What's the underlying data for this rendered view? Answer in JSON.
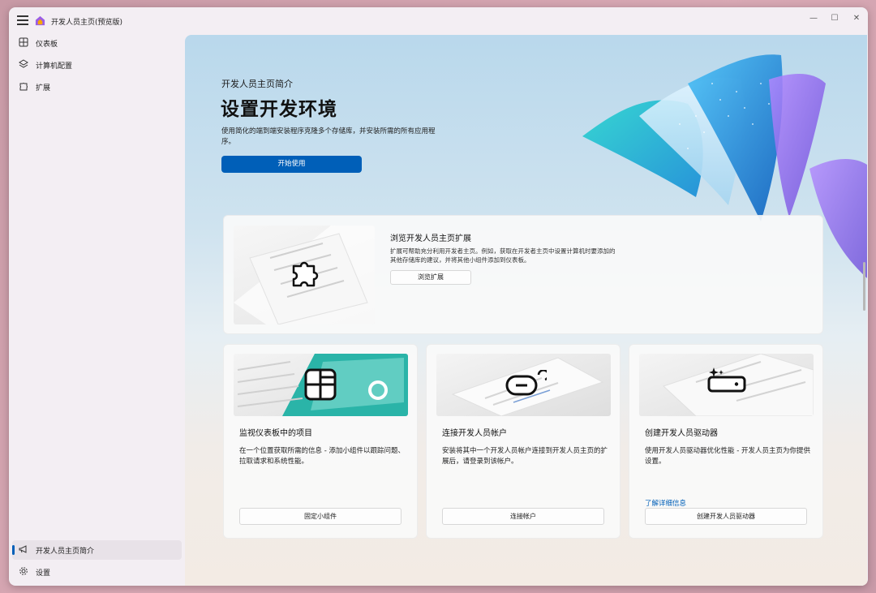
{
  "window": {
    "title": "开发人员主页(预览版)",
    "controls": {
      "minimize": "—",
      "maximize": "☐",
      "close": "✕"
    }
  },
  "sidebar": {
    "items": [
      {
        "label": "仪表板",
        "icon": "dashboard-icon"
      },
      {
        "label": "计算机配置",
        "icon": "layers-icon"
      },
      {
        "label": "扩展",
        "icon": "puzzle-icon"
      }
    ],
    "footer_items": [
      {
        "label": "开发人员主页简介",
        "icon": "megaphone-icon",
        "active": true
      },
      {
        "label": "设置",
        "icon": "gear-icon"
      }
    ]
  },
  "hero": {
    "subtitle": "开发人员主页简介",
    "title": "设置开发环境",
    "description": "使用简化的端到端安装程序克隆多个存储库，并安装所需的所有应用程序。",
    "button": "开始使用"
  },
  "extensions_card": {
    "title": "浏览开发人员主页扩展",
    "description": "扩展可帮助充分利用开发者主页。例如，获取在开发者主页中设置计算机时要添加的其他存储库的建议，并将其他小组件添加到仪表板。",
    "button": "浏览扩展"
  },
  "cards": [
    {
      "title": "监视仪表板中的项目",
      "description": "在一个位置获取所需的信息 - 添加小组件以跟踪问题、拉取请求和系统性能。",
      "button": "固定小组件",
      "icon": "widget-grid-icon"
    },
    {
      "title": "连接开发人员帐户",
      "description": "安装将其中一个开发人员帐户连接到开发人员主页的扩展后，请登录到该帐户。",
      "button": "连接帐户",
      "icon": "link-icon"
    },
    {
      "title": "创建开发人员驱动器",
      "description": "使用开发人员驱动器优化性能 - 开发人员主页为你提供设置。",
      "link": "了解详细信息",
      "button": "创建开发人员驱动器",
      "icon": "dev-drive-icon"
    }
  ],
  "colors": {
    "accent": "#005fb8"
  }
}
